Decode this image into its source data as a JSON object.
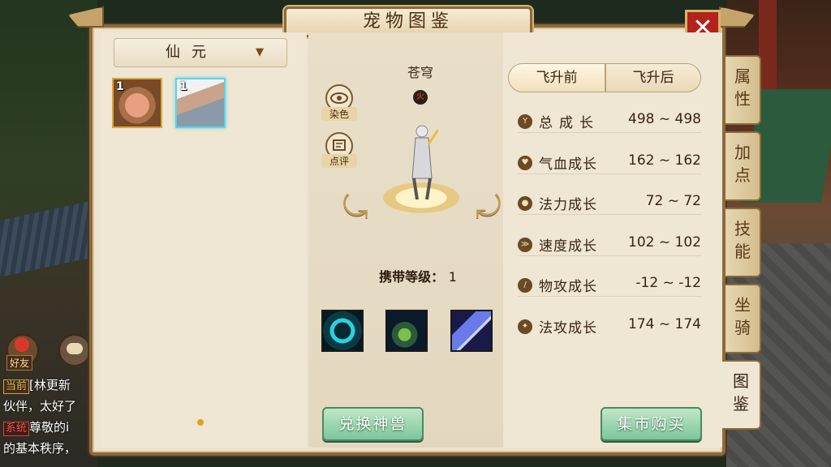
{
  "window": {
    "title": "宠物图鉴",
    "close_label": "✕"
  },
  "filter": {
    "selected": "仙元"
  },
  "pets": [
    {
      "level": "1",
      "kind": "pig"
    },
    {
      "level": "1",
      "kind": "fairy",
      "selected": true
    }
  ],
  "detail": {
    "name": "苍穹",
    "element": "火",
    "dye_label": "染色",
    "comment_label": "点评",
    "carry_label": "携带等级：",
    "carry_value": "1"
  },
  "tabs": {
    "before": "飞升前",
    "after": "飞升后"
  },
  "stats": [
    {
      "label": "总成长",
      "value": "498 ~ 498",
      "icon": "total-growth-icon"
    },
    {
      "label": "气血成长",
      "value": "162 ~ 162",
      "icon": "hp-growth-icon"
    },
    {
      "label": "法力成长",
      "value": "72 ~ 72",
      "icon": "mp-growth-icon"
    },
    {
      "label": "速度成长",
      "value": "102 ~ 102",
      "icon": "speed-growth-icon"
    },
    {
      "label": "物攻成长",
      "value": "-12 ~ -12",
      "icon": "physical-attack-growth-icon"
    },
    {
      "label": "法攻成长",
      "value": "174 ~ 174",
      "icon": "magic-attack-growth-icon"
    }
  ],
  "buttons": {
    "exchange": "兑换神兽",
    "market": "集市购买"
  },
  "side_tabs": [
    "属性",
    "加点",
    "技能",
    "坐骑",
    "图鉴"
  ],
  "chat": {
    "friend": "好友",
    "line1_channel": "当前",
    "line1_text": "[林更新",
    "line2_text": "伙伴，太好了",
    "line3_channel": "系统",
    "line3_text": "尊敬的i",
    "line4_text": "的基本秩序，"
  },
  "colors": {
    "panel_bg": "#eee3ce",
    "frame": "#8b6a3c",
    "button_green": "#7cc69a",
    "close_red": "#b2231c",
    "selection_cyan": "#5ad6e6"
  }
}
